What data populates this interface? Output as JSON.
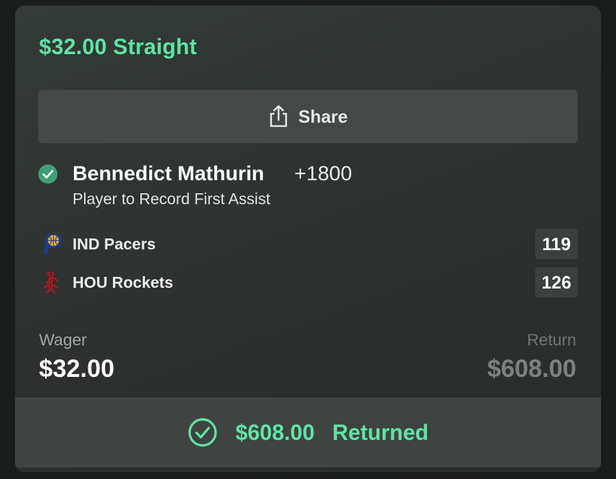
{
  "bet": {
    "title": "$32.00 Straight",
    "share_label": "Share",
    "player": "Bennedict Mathurin",
    "odds": "+1800",
    "market": "Player to Record First Assist"
  },
  "teams": [
    {
      "name": "IND Pacers",
      "score": "119",
      "logo_icon": "pacers-logo-icon"
    },
    {
      "name": "HOU Rockets",
      "score": "126",
      "logo_icon": "rockets-logo-icon"
    }
  ],
  "summary": {
    "wager_label": "Wager",
    "wager_value": "$32.00",
    "return_label": "Return",
    "return_value": "$608.00"
  },
  "footer": {
    "amount": "$608.00",
    "status": "Returned"
  },
  "colors": {
    "accent_green": "#5fe4a3",
    "check_green": "#3f9f72"
  }
}
